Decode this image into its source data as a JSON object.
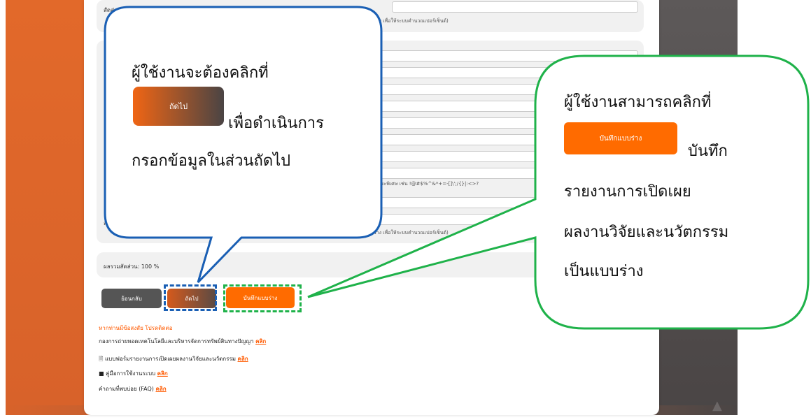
{
  "form": {
    "share_label_top": "สัดส่วน (%",
    "share_hint_top": "นพื้นที่ว่าง เพื่อให้ระบบคำนวณเปอร์เซ็นต์)",
    "special_char_hint": "ขระพิเศษ เช่น !@#$%^&*+=-[]\\';/{}|:<>?",
    "share_label_bottom": "สัด",
    "share_hint_bottom": "นพื้นที่ว่าง เพื่อให้ระบบคำนวณเปอร์เซ็นต์)",
    "total_share": "ผลรวมสัดส่วน: 100 %"
  },
  "buttons": {
    "back": "ย้อนกลับ",
    "next": "ถัดไป",
    "save_draft": "บันทึกแบบร่าง"
  },
  "footer": {
    "title": "หากท่านมีข้อสงสัย โปรดติดต่อ",
    "link_label": "คลิก",
    "lines": [
      "กองการถ่ายทอดเทคโนโลยีและบริหารจัดการทรัพย์สินทางปัญญา",
      "แบบฟอร์มรายงานการเปิดเผยผลงานวิจัยและนวัตกรรม",
      "คู่มือการใช้งานระบบ",
      "คำถามที่พบบ่อย (FAQ)"
    ]
  },
  "callout_left": {
    "line1": "ผู้ใช้งานจะต้องคลิกที่",
    "button": "ถัดไป",
    "line2": "เพื่อดำเนินการ",
    "line3": "กรอกข้อมูลในส่วนถัดไป"
  },
  "callout_right": {
    "line1": "ผู้ใช้งานสามารถคลิกที่",
    "button": "บันทึกแบบร่าง",
    "line2": "บันทึก",
    "line3": "รายงานการเปิดเผย",
    "line4": "ผลงานวิจัยและนวัตกรรม",
    "line5": "เป็นแบบร่าง"
  },
  "colors": {
    "brand_orange": "#ff6b00",
    "callout_blue": "#1a5fb4",
    "callout_green": "#1fb24a"
  },
  "icons": [
    "document-icon",
    "book-icon",
    "arrow-up-icon"
  ]
}
